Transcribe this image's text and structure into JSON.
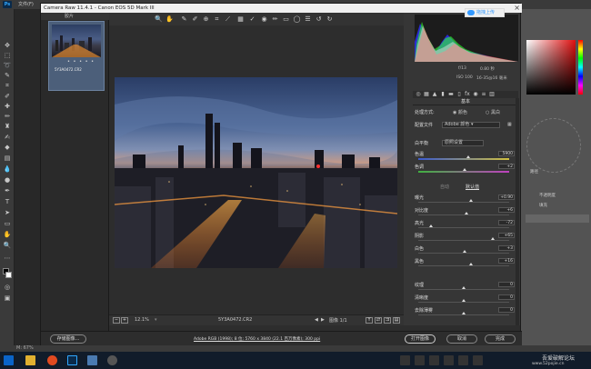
{
  "ps": {
    "logo": "Ps",
    "menu_file": "文件(F)",
    "zoom_status": "M: 67%",
    "panels": {
      "paths": "路径",
      "opacity": "不透明度",
      "fill": "填充"
    }
  },
  "camera_raw": {
    "title": "Camera Raw 11.4.1 - Canon EOS 5D Mark III",
    "upload_button": "拖拽上传",
    "filmstrip_header": "胶片",
    "thumb_rating": "• • • • •",
    "filename": "5Y3A0472.CR2",
    "zoom_value": "12.1%",
    "image_counter": "图像 1/1",
    "workflow_link": "Adobe RGB (1998); 8 位; 5760 x 3840 (22.1 百万像素); 300 ppi",
    "buttons": {
      "save": "存储图像...",
      "open": "打开图像",
      "cancel": "取消",
      "done": "完成"
    }
  },
  "histogram": {
    "aperture": "f/13",
    "shutter": "0.80 秒",
    "iso": "ISO 100",
    "lens": "16-35@16 毫米"
  },
  "basic": {
    "section_title": "基本",
    "treatment_label": "处理方式:",
    "treatment_color": "颜色",
    "treatment_bw": "黑白",
    "profile_label": "配置文件",
    "profile_value": "Adobe 颜色",
    "wb_label": "白平衡",
    "wb_value": "原照设置",
    "auto": "自动",
    "default": "默认值",
    "sliders": [
      {
        "label": "色温",
        "value": "5900",
        "pos": 0.55
      },
      {
        "label": "色调",
        "value": "+2",
        "pos": 0.51
      },
      {
        "label": "曝光",
        "value": "+0.90",
        "pos": 0.58
      },
      {
        "label": "对比度",
        "value": "+6",
        "pos": 0.53
      },
      {
        "label": "高光",
        "value": "-72",
        "pos": 0.14
      },
      {
        "label": "阴影",
        "value": "+65",
        "pos": 0.82
      },
      {
        "label": "白色",
        "value": "+3",
        "pos": 0.51
      },
      {
        "label": "黑色",
        "value": "+16",
        "pos": 0.58
      },
      {
        "label": "纹理",
        "value": "0",
        "pos": 0.5
      },
      {
        "label": "清晰度",
        "value": "0",
        "pos": 0.5
      },
      {
        "label": "去除薄雾",
        "value": "0",
        "pos": 0.5
      }
    ]
  },
  "taskbar": {
    "watermark": "吾爱破解论坛",
    "watermark_url": "www.52pojie.cn"
  }
}
